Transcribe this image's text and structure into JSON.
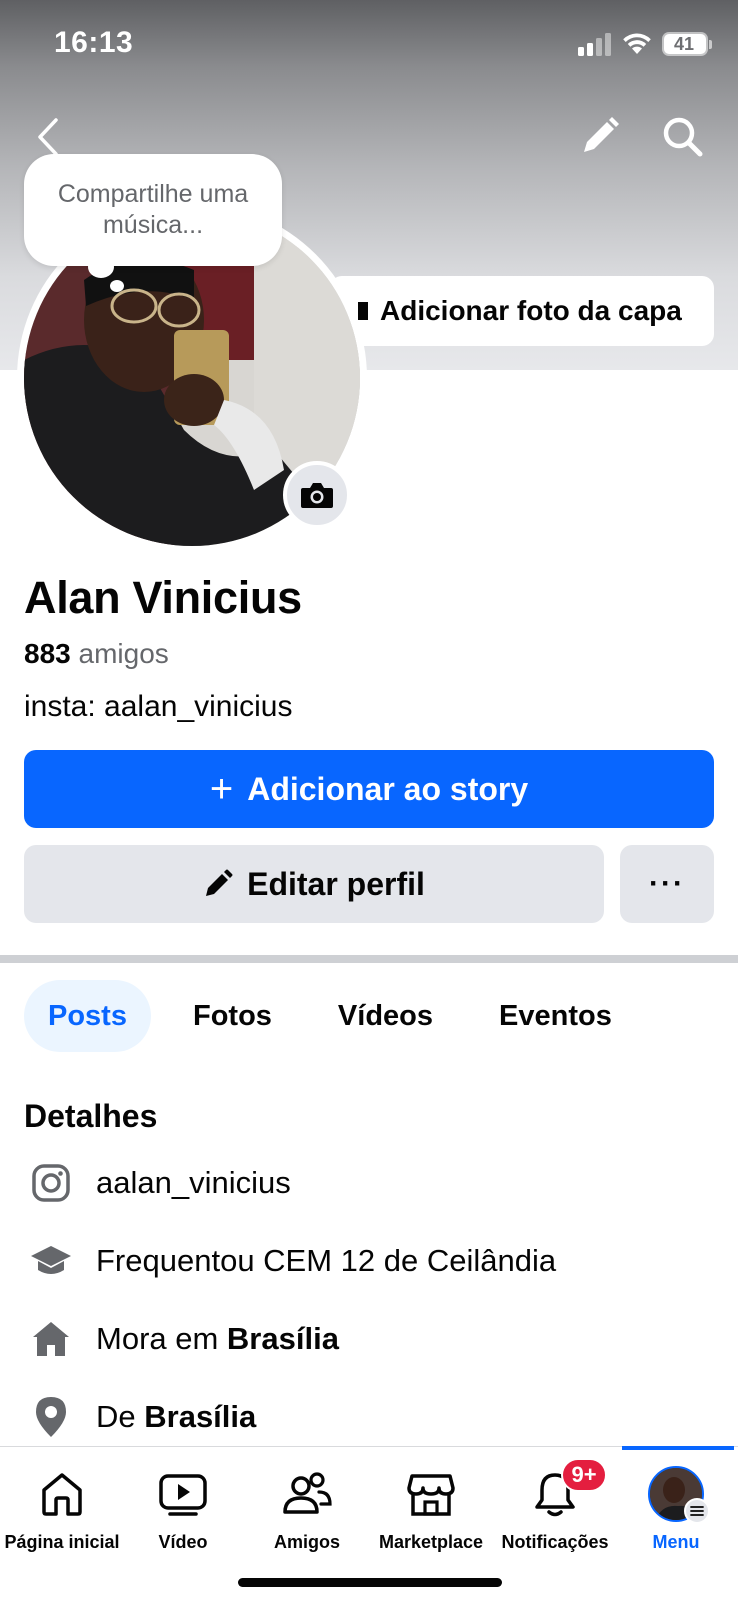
{
  "status_bar": {
    "time": "16:13",
    "battery": "41"
  },
  "header": {
    "back_icon": "chevron-left-icon",
    "edit_icon": "pencil-icon",
    "search_icon": "search-icon"
  },
  "cover": {
    "add_cover_label": "Adicionar foto da capa"
  },
  "note": {
    "text": "Compartilhe uma música..."
  },
  "profile": {
    "name": "Alan Vinicius",
    "friends_count": "883",
    "friends_label": "amigos",
    "bio": "insta: aalan_vinicius"
  },
  "actions": {
    "add_story_label": "Adicionar ao story",
    "edit_profile_label": "Editar perfil",
    "more_label": "···"
  },
  "tabs": [
    {
      "label": "Posts",
      "active": true
    },
    {
      "label": "Fotos",
      "active": false
    },
    {
      "label": "Vídeos",
      "active": false
    },
    {
      "label": "Eventos",
      "active": false
    }
  ],
  "details": {
    "title": "Detalhes",
    "items": [
      {
        "icon": "instagram-icon",
        "prefix": "aalan_vinicius",
        "bold": ""
      },
      {
        "icon": "graduation-cap-icon",
        "prefix": "Frequentou CEM 12 de Ceilândia",
        "bold": ""
      },
      {
        "icon": "home-icon",
        "prefix": "Mora em ",
        "bold": "Brasília"
      },
      {
        "icon": "location-pin-icon",
        "prefix": "De ",
        "bold": "Brasília"
      }
    ]
  },
  "bottom_nav": [
    {
      "label": "Página inicial",
      "icon": "home-icon"
    },
    {
      "label": "Vídeo",
      "icon": "video-icon"
    },
    {
      "label": "Amigos",
      "icon": "friends-icon"
    },
    {
      "label": "Marketplace",
      "icon": "marketplace-icon"
    },
    {
      "label": "Notificações",
      "icon": "bell-icon",
      "badge": "9+"
    },
    {
      "label": "Menu",
      "icon": "avatar",
      "active": true
    }
  ],
  "colors": {
    "accent": "#0866ff",
    "badge": "#e41e3f",
    "secondary_button": "#e4e6eb"
  }
}
